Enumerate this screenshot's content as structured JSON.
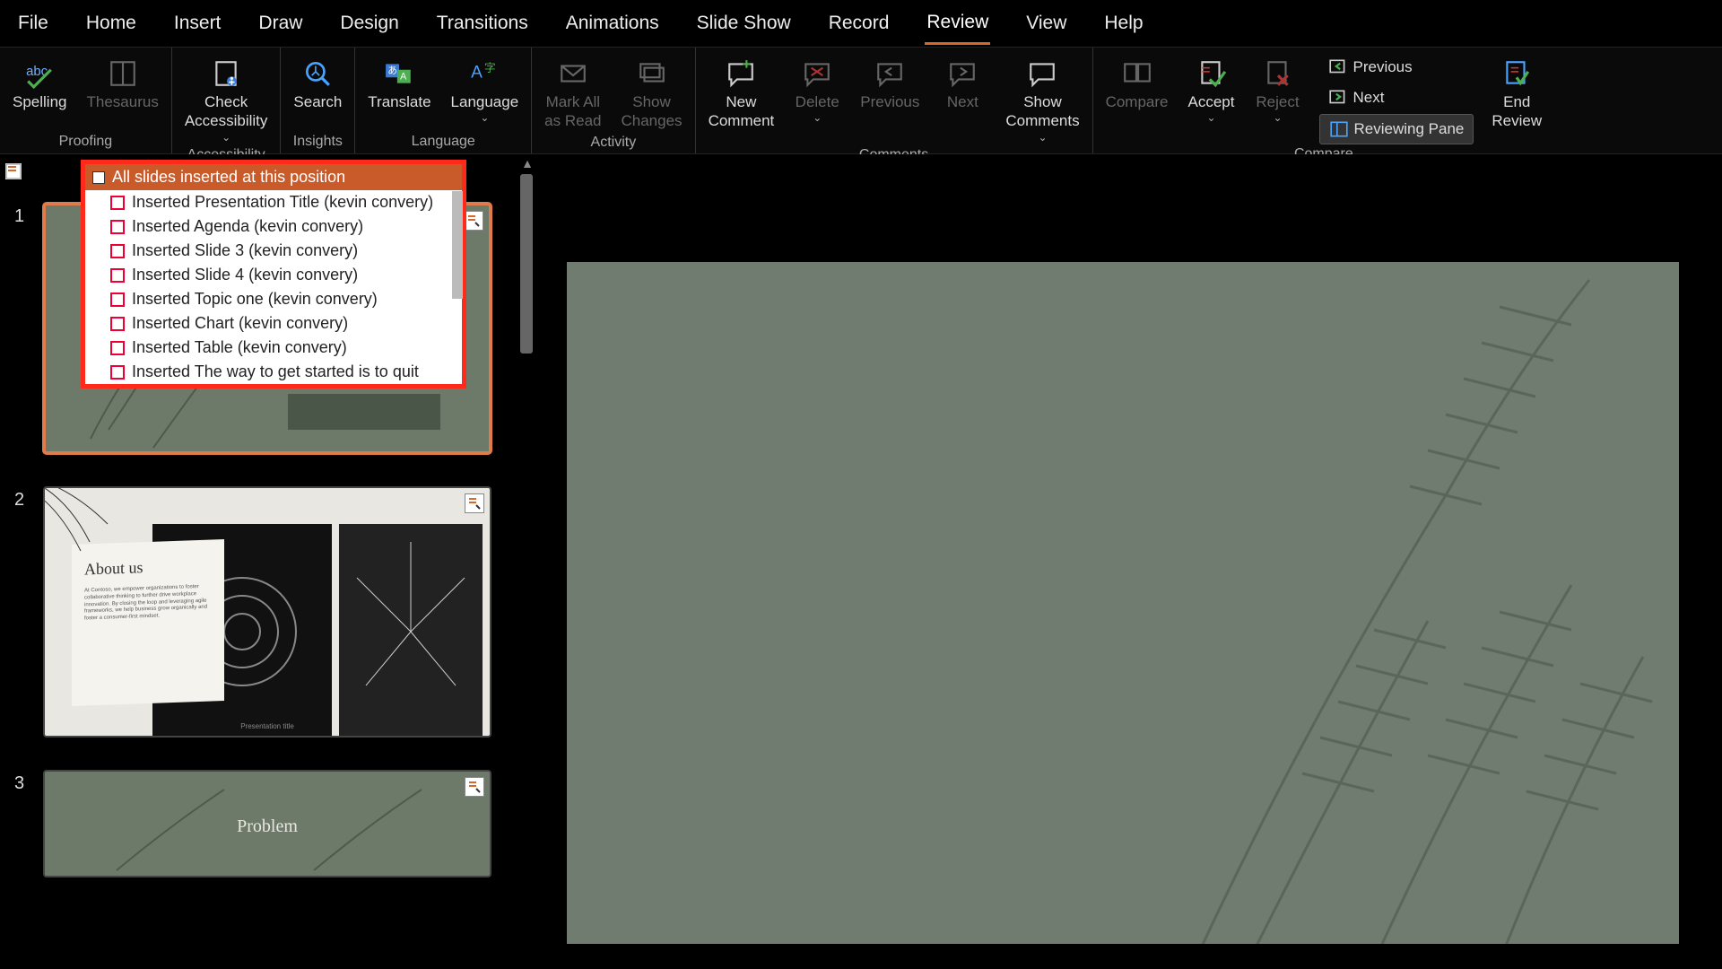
{
  "menu": {
    "items": [
      "File",
      "Home",
      "Insert",
      "Draw",
      "Design",
      "Transitions",
      "Animations",
      "Slide Show",
      "Record",
      "Review",
      "View",
      "Help"
    ],
    "active": "Review"
  },
  "ribbon": {
    "groups": {
      "proofing": {
        "label": "Proofing",
        "spelling": "Spelling",
        "thesaurus": "Thesaurus"
      },
      "accessibility": {
        "label": "Accessibility",
        "check": "Check\nAccessibility"
      },
      "insights": {
        "label": "Insights",
        "search": "Search"
      },
      "language": {
        "label": "Language",
        "translate": "Translate",
        "languageBtn": "Language"
      },
      "activity": {
        "label": "Activity",
        "markAll": "Mark All\nas Read",
        "showChanges": "Show\nChanges"
      },
      "comments": {
        "label": "Comments",
        "new": "New\nComment",
        "delete": "Delete",
        "previous": "Previous",
        "next": "Next",
        "show": "Show\nComments"
      },
      "compare": {
        "label": "Compare",
        "compare": "Compare",
        "accept": "Accept",
        "reject": "Reject",
        "prev": "Previous",
        "nxt": "Next",
        "pane": "Reviewing Pane",
        "end": "End\nReview"
      }
    }
  },
  "revisionPopup": {
    "header": "All slides inserted at this position",
    "items": [
      "Inserted Presentation Title (kevin convery)",
      "Inserted Agenda (kevin convery)",
      "Inserted Slide 3 (kevin convery)",
      "Inserted Slide 4 (kevin convery)",
      "Inserted Topic one (kevin convery)",
      "Inserted Chart (kevin convery)",
      "Inserted Table (kevin convery)",
      "Inserted The way to get started is to quit"
    ]
  },
  "slides": {
    "s1": {
      "num": "1"
    },
    "s2": {
      "num": "2",
      "aboutTitle": "About us",
      "aboutBody": "At Contoso, we empower organizations to foster collaborative thinking to further drive workplace innovation. By closing the loop and leveraging agile frameworks, we help business grow organically and foster a consumer-first mindset.",
      "footer": "Presentation title"
    },
    "s3": {
      "num": "3",
      "title": "Problem"
    }
  }
}
